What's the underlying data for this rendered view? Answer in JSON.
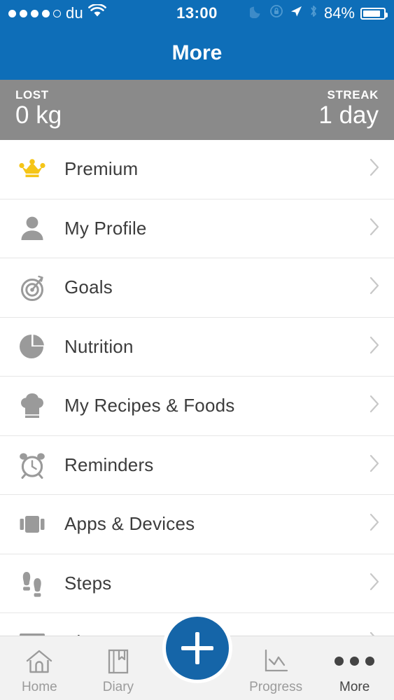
{
  "status_bar": {
    "signal_dots_filled": 4,
    "signal_dots_total": 5,
    "carrier": "du",
    "wifi_icon": "wifi-icon",
    "time": "13:00",
    "moon_icon": "do-not-disturb-moon-icon",
    "rotation_lock_icon": "rotation-lock-icon",
    "location_icon": "location-arrow-icon",
    "bluetooth_icon": "bluetooth-icon",
    "battery_percent": "84%",
    "battery_level": 84
  },
  "navbar": {
    "title": "More"
  },
  "stats": {
    "lost": {
      "label": "LOST",
      "value": "0 kg"
    },
    "streak": {
      "label": "STREAK",
      "value": "1 day"
    }
  },
  "menu": {
    "items": [
      {
        "label": "Premium",
        "icon": "crown-icon"
      },
      {
        "label": "My Profile",
        "icon": "person-icon"
      },
      {
        "label": "Goals",
        "icon": "target-icon"
      },
      {
        "label": "Nutrition",
        "icon": "pie-chart-icon"
      },
      {
        "label": "My Recipes & Foods",
        "icon": "chef-hat-icon"
      },
      {
        "label": "Reminders",
        "icon": "alarm-clock-icon"
      },
      {
        "label": "Apps & Devices",
        "icon": "devices-icon"
      },
      {
        "label": "Steps",
        "icon": "footprints-icon"
      },
      {
        "label": "Blog",
        "icon": "newspaper-icon"
      }
    ],
    "chevron_icon": "chevron-right-icon"
  },
  "tabbar": {
    "tabs": [
      {
        "label": "Home",
        "icon": "home-icon",
        "active": false
      },
      {
        "label": "Diary",
        "icon": "book-icon",
        "active": false
      },
      {
        "label": "Progress",
        "icon": "line-chart-icon",
        "active": false
      },
      {
        "label": "More",
        "icon": "ellipsis-icon",
        "active": true
      }
    ],
    "fab": {
      "icon": "plus-icon",
      "label": "+"
    }
  },
  "colors": {
    "header_blue": "#0E6EB8",
    "fab_blue": "#1565A8",
    "stats_gray": "#8a8a8a",
    "crown_gold": "#F5C518",
    "icon_gray": "#9a9a9a",
    "text_dark": "#3c3c3c",
    "tab_inactive": "#9b9b9b",
    "tab_active": "#444444"
  }
}
